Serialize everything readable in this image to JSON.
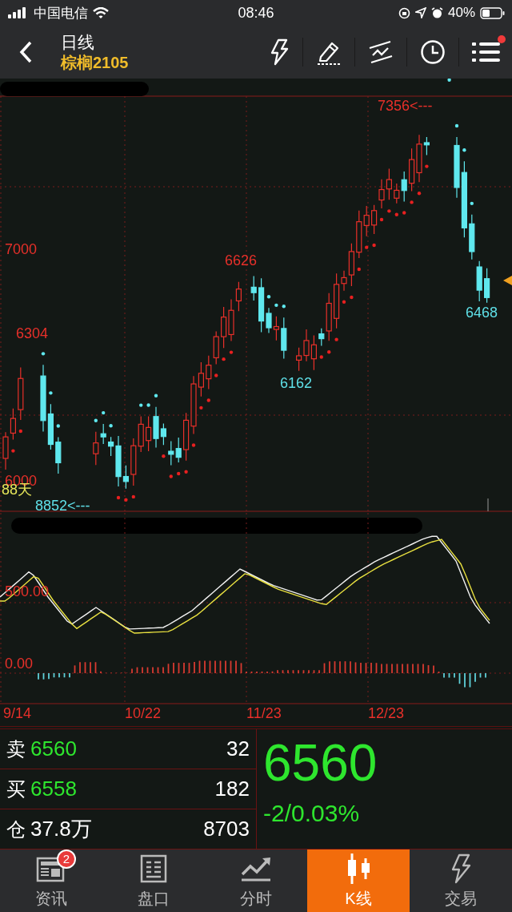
{
  "status_bar": {
    "carrier": "中国电信",
    "time": "08:46",
    "battery": "40%"
  },
  "header": {
    "title": "日线",
    "symbol": "棕榈2105",
    "notification": true
  },
  "main_chart": {
    "axis_labels": [
      "7000",
      "6000"
    ],
    "annotations": [
      {
        "text": "7356<---",
        "kind": "high"
      },
      {
        "text": "6626",
        "kind": "high"
      },
      {
        "text": "6304",
        "kind": "high"
      },
      {
        "text": "6162",
        "kind": "low"
      },
      {
        "text": "6468",
        "kind": "low"
      },
      {
        "text": "8852<---",
        "kind": "low"
      },
      {
        "text": "88天",
        "kind": "count"
      }
    ]
  },
  "indicator_chart": {
    "axis_labels": [
      "500.00",
      "0.00"
    ]
  },
  "dates": [
    "9/14",
    "10/22",
    "11/23",
    "12/23"
  ],
  "quote": {
    "rows": [
      {
        "label": "卖",
        "value": "6560",
        "volume": "32",
        "kind": "price"
      },
      {
        "label": "买",
        "value": "6558",
        "volume": "182",
        "kind": "price"
      },
      {
        "label": "仓",
        "value": "37.8万",
        "volume": "8703",
        "kind": "plain"
      }
    ],
    "last": "6560",
    "change": "-2/0.03%"
  },
  "tabs": [
    {
      "label": "资讯",
      "badge": "2",
      "selected": false
    },
    {
      "label": "盘口",
      "selected": false
    },
    {
      "label": "分时",
      "selected": false
    },
    {
      "label": "K线",
      "selected": true
    },
    {
      "label": "交易",
      "selected": false
    }
  ]
}
